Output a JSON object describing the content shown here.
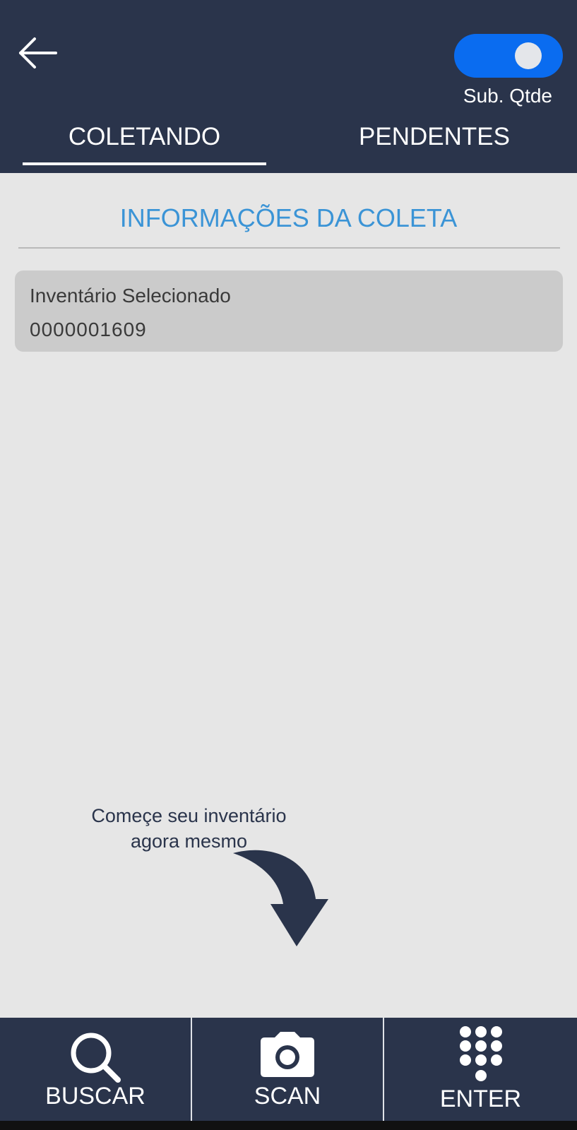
{
  "header": {
    "toggle": {
      "label": "Sub. Qtde",
      "on": true,
      "color": "#0a6cf0"
    },
    "tabs": [
      {
        "label": "COLETANDO",
        "active": true
      },
      {
        "label": "PENDENTES",
        "active": false
      }
    ],
    "background": "#2a344b"
  },
  "main": {
    "section_title": "INFORMAÇÕES DA COLETA",
    "card": {
      "label": "Inventário Selecionado",
      "value": "0000001609"
    },
    "hint": {
      "line1": "Começe seu inventário",
      "line2": "agora mesmo"
    }
  },
  "bottom_bar": {
    "buttons": [
      {
        "label": "BUSCAR",
        "icon": "search-icon"
      },
      {
        "label": "SCAN",
        "icon": "camera-icon"
      },
      {
        "label": "ENTER",
        "icon": "keypad-icon"
      }
    ]
  },
  "colors": {
    "accent": "#3b94d6",
    "navy": "#2a344b",
    "background": "#e6e6e6",
    "card": "#cbcbcb"
  }
}
